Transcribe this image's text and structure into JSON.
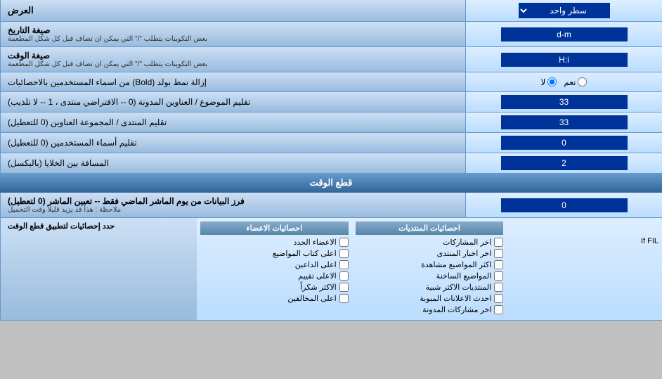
{
  "title": "العرض",
  "sections": {
    "main": {
      "row1": {
        "label": "سطر واحد",
        "select_value": "سطر واحد"
      },
      "date_format": {
        "label": "صيغة التاريخ",
        "sub_label": "بعض التكوينات يتطلب \"/\" التي يمكن ان تضاف قبل كل شكل المطعمة",
        "value": "d-m"
      },
      "time_format": {
        "label": "صيغة الوقت",
        "sub_label": "بعض التكوينات يتطلب \"/\" التي يمكن ان تضاف قبل كل شكل المطعمة",
        "value": "H:i"
      },
      "bold_remove": {
        "label": "إزالة نمط بولد (Bold) من اسماء المستخدمين بالاحصائيات",
        "radio_yes": "نعم",
        "radio_no": "لا",
        "selected": "no"
      },
      "topic_address": {
        "label": "تقليم الموضوع / العناوين المدونة (0 -- الافتراضي منتدى ، 1 -- لا تلذيب)",
        "value": "33"
      },
      "forum_address": {
        "label": "تقليم المنتدى / المجموعة العناوين (0 للتعطيل)",
        "value": "33"
      },
      "username_trim": {
        "label": "تقليم أسماء المستخدمين (0 للتعطيل)",
        "value": "0"
      },
      "cell_spacing": {
        "label": "المسافة بين الخلايا (بالبكسل)",
        "value": "2"
      }
    },
    "cutoff": {
      "title": "قطع الوقت",
      "filter_value": "0",
      "filter_label": "فرز البيانات من يوم الماشر الماضي فقط -- تعيين الماشر (0 لتعطيل)",
      "filter_note": "ملاحظة : هذا قد يزيد قليلاً وقت التحميل",
      "limit_label": "حدد إحصائيات لتطبيق قطع الوقت"
    },
    "checkboxes": {
      "col_left": {
        "header": "احصائيات الاعضاء",
        "items": [
          "الاعضاء الجدد",
          "اعلى كتاب المواضيع",
          "اعلى الداعين",
          "الاعلى تقييم",
          "الاكثر شكراً",
          "اعلى المخالفين"
        ]
      },
      "col_middle": {
        "header": "احصائيات المنتديات",
        "items": [
          "اخر المشاركات",
          "اخر اخبار المنتدى",
          "اكثر المواضيع مشاهدة",
          "المواضيع الساخنة",
          "المنتديات الاكثر شبية",
          "احدث الاعلانات المبوبة",
          "اخر مشاركات المدونة"
        ]
      },
      "col_right": {
        "header": "",
        "items": []
      }
    }
  }
}
